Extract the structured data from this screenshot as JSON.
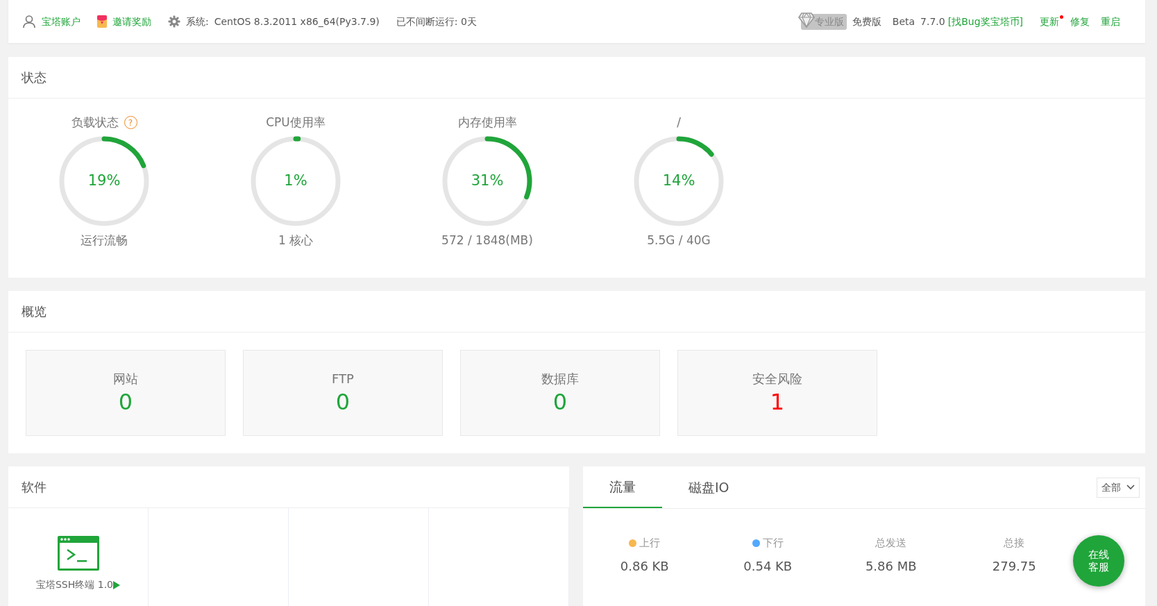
{
  "top_bar": {
    "account": "宝塔账户",
    "invite": "邀请奖励",
    "system_label": "系统:",
    "system_value": "CentOS 8.3.2011 x86_64(Py3.7.9)",
    "uptime": "已不间断运行: 0天",
    "pro_badge": "专业版",
    "edition": "免费版",
    "channel": "Beta",
    "version": "7.7.0",
    "bug_link": "[找Bug奖宝塔币]",
    "actions": [
      {
        "label": "更新",
        "notification": true
      },
      {
        "label": "修复",
        "notification": false
      },
      {
        "label": "重启",
        "notification": false
      }
    ]
  },
  "status": {
    "title": "状态",
    "gauges": [
      {
        "title": "负载状态",
        "help": "?",
        "value": "19%",
        "level": 0.19,
        "caption": "运行流畅"
      },
      {
        "title": "CPU使用率",
        "value": "1%",
        "level": 0.01,
        "caption": "1 核心"
      },
      {
        "title": "内存使用率",
        "value": "31%",
        "level": 0.31,
        "caption": "572 / 1848(MB)"
      },
      {
        "title": "/",
        "value": "14%",
        "level": 0.14,
        "caption": "5.5G / 40G"
      }
    ]
  },
  "overview": {
    "title": "概览",
    "items": [
      {
        "label": "网站",
        "value": "0",
        "alert": false
      },
      {
        "label": "FTP",
        "value": "0",
        "alert": false
      },
      {
        "label": "数据库",
        "value": "0",
        "alert": false
      },
      {
        "label": "安全风险",
        "value": "1",
        "alert": true
      }
    ]
  },
  "software": {
    "title": "软件",
    "items": [
      {
        "name": "宝塔SSH终端 1.0"
      }
    ]
  },
  "traffic": {
    "tabs": [
      {
        "label": "流量",
        "selected": true
      },
      {
        "label": "磁盘IO",
        "selected": false
      }
    ],
    "select": "全部",
    "stats": [
      {
        "label": "上行",
        "value": "0.86 KB",
        "color": "#f7b851"
      },
      {
        "label": "下行",
        "value": "0.54 KB",
        "color": "#52a9ff"
      },
      {
        "label": "总发送",
        "value": "5.86 MB"
      },
      {
        "label": "总接",
        "value": "279.75"
      }
    ]
  },
  "chat_button": [
    "在线",
    "客服"
  ]
}
